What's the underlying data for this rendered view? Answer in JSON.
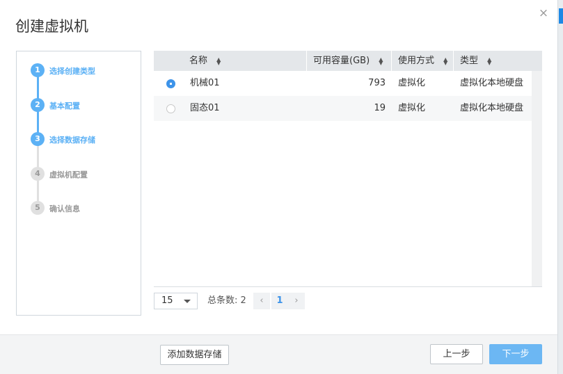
{
  "dialog": {
    "title": "创建虚拟机",
    "close_icon": "×"
  },
  "steps": [
    {
      "num": "1",
      "label": "选择创建类型",
      "state": "done"
    },
    {
      "num": "2",
      "label": "基本配置",
      "state": "done"
    },
    {
      "num": "3",
      "label": "选择数据存储",
      "state": "current"
    },
    {
      "num": "4",
      "label": "虚拟机配置",
      "state": "pending"
    },
    {
      "num": "5",
      "label": "确认信息",
      "state": "pending"
    }
  ],
  "table": {
    "columns": [
      "名称",
      "可用容量(GB)",
      "使用方式",
      "类型"
    ],
    "rows": [
      {
        "selected": true,
        "name": "机械01",
        "capacity": "793",
        "usage": "虚拟化",
        "type": "虚拟化本地硬盘"
      },
      {
        "selected": false,
        "name": "固态01",
        "capacity": "19",
        "usage": "虚拟化",
        "type": "虚拟化本地硬盘"
      }
    ]
  },
  "pager": {
    "page_size": "15",
    "total": "总条数: 2",
    "prev_icon": "‹",
    "current_page": "1",
    "next_icon": "›"
  },
  "footer": {
    "add_storage": "添加数据存储",
    "prev": "上一步",
    "next": "下一步"
  },
  "colors": {
    "accent": "#5cb1f5",
    "primary_button": "#6cb7f3",
    "radio_checked": "#3d93e9"
  }
}
